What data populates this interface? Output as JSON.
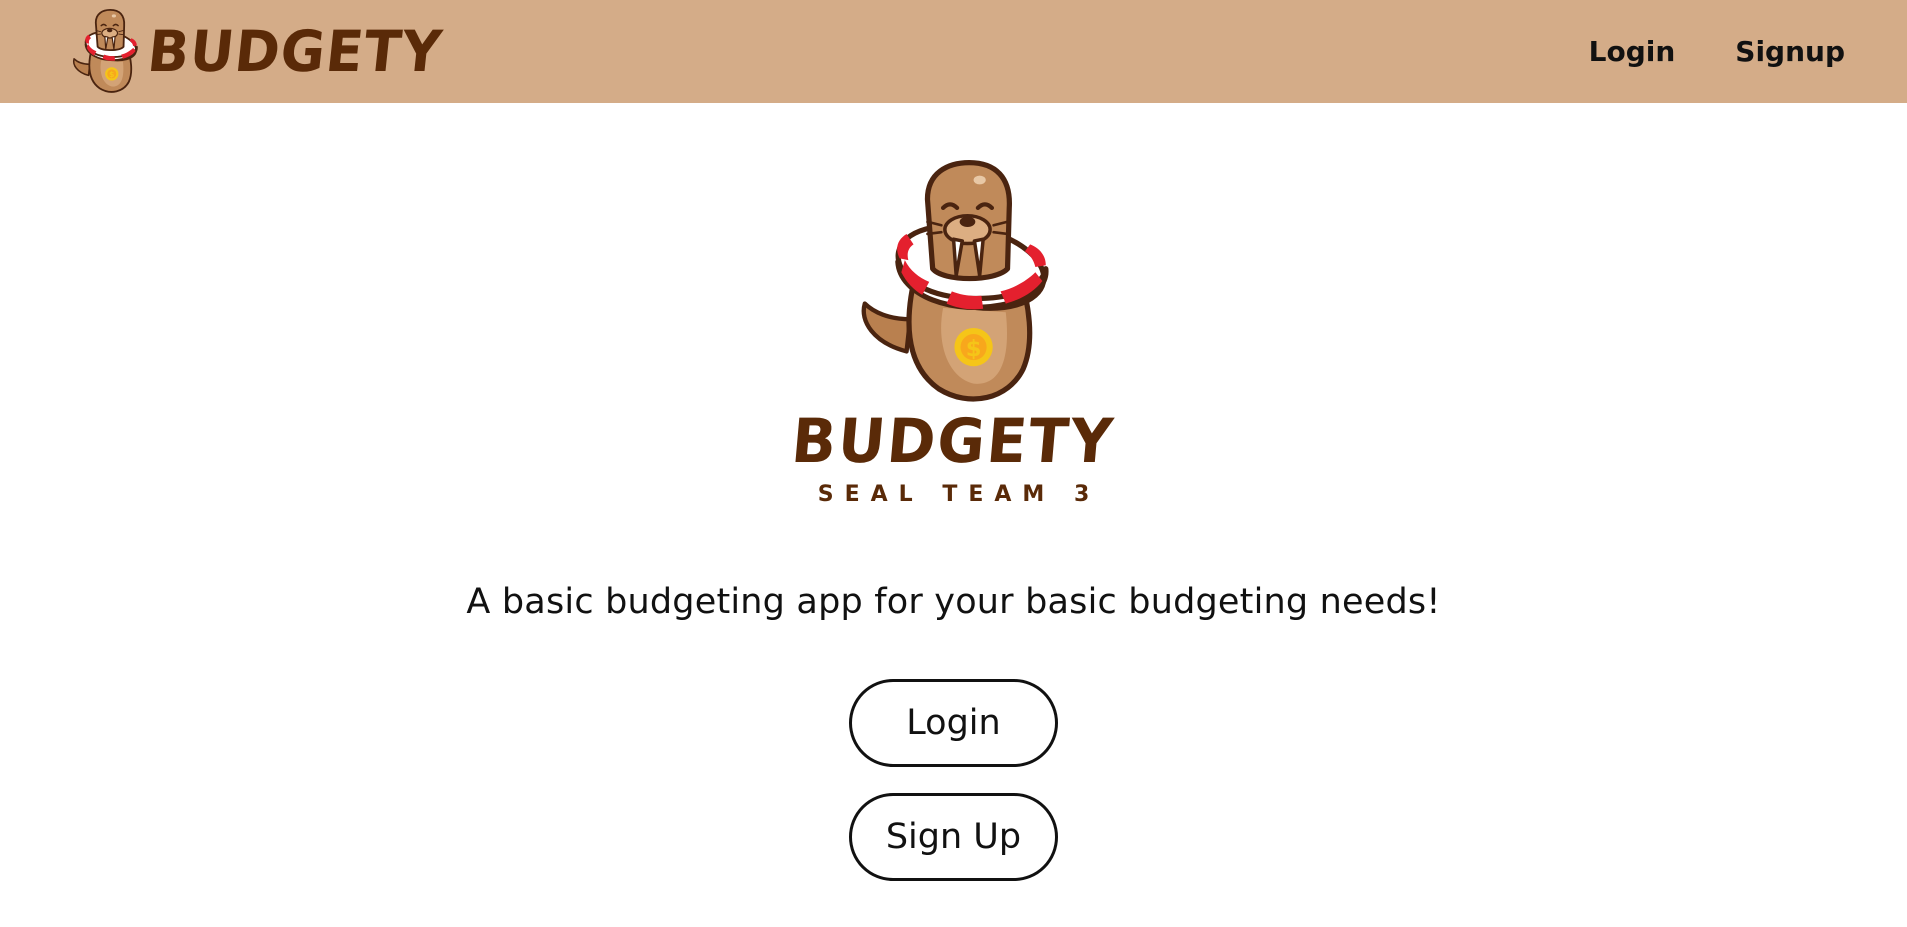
{
  "navbar": {
    "brand_logo_icon": "walrus-mascot-icon",
    "brand_name": "BUDGETY",
    "links": [
      {
        "label": "Login"
      },
      {
        "label": "Signup"
      }
    ]
  },
  "hero": {
    "logo_icon": "walrus-mascot-icon",
    "brand_name": "BUDGETY",
    "tagline": "SEAL TEAM 3",
    "description": "A basic budgeting app for your basic budgeting needs!"
  },
  "actions": {
    "login_label": "Login",
    "signup_label": "Sign Up"
  },
  "colors": {
    "navbar_bg": "#d4ac88",
    "brand_brown": "#5a2a08",
    "text": "#111111",
    "ring_red": "#e4202e",
    "coin_gold": "#f5c518"
  }
}
